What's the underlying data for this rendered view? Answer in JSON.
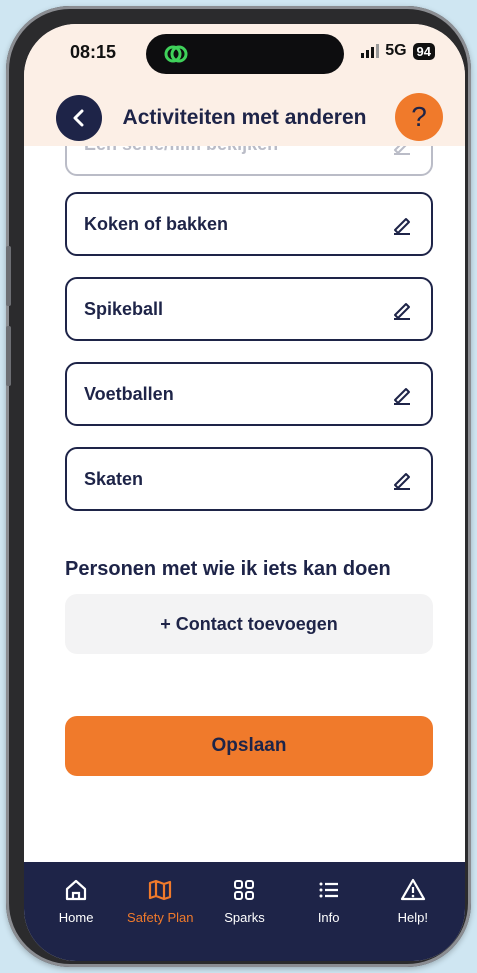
{
  "status": {
    "time": "08:15",
    "network": "5G",
    "battery": "94"
  },
  "header": {
    "title": "Activiteiten met anderen",
    "help_label": "?"
  },
  "activities": [
    {
      "label": "Een serie/film bekijken"
    },
    {
      "label": "Koken of bakken"
    },
    {
      "label": "Spikeball"
    },
    {
      "label": "Voetballen"
    },
    {
      "label": "Skaten"
    }
  ],
  "contacts": {
    "section_title": "Personen met wie ik iets kan doen",
    "add_label": "+ Contact toevoegen"
  },
  "save_label": "Opslaan",
  "tabbar": {
    "items": [
      {
        "label": "Home",
        "icon": "home-icon"
      },
      {
        "label": "Safety Plan",
        "icon": "map-icon",
        "active": true
      },
      {
        "label": "Sparks",
        "icon": "grid-icon"
      },
      {
        "label": "Info",
        "icon": "list-icon"
      },
      {
        "label": "Help!",
        "icon": "warning-icon"
      }
    ]
  },
  "colors": {
    "navy": "#1e2448",
    "orange": "#f07a2b",
    "peach": "#fcefe6"
  }
}
